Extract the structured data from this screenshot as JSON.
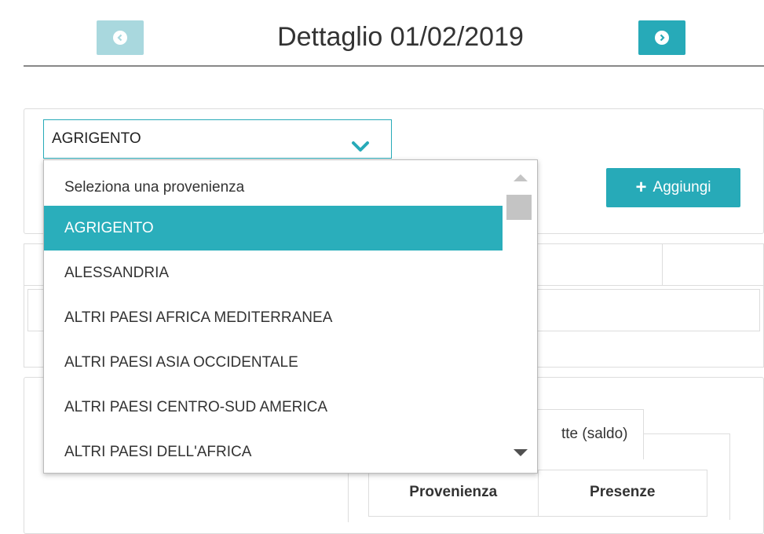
{
  "header": {
    "title": "Dettaglio 01/02/2019",
    "prev_icon": "arrow-left-circle-icon",
    "next_icon": "arrow-right-circle-icon"
  },
  "colors": {
    "accent": "#27aab8",
    "accent_disabled": "#a9d8de",
    "selected_option": "#2aaebb"
  },
  "select": {
    "value": "AGRIGENTO",
    "icon": "chevron-down-icon"
  },
  "dropdown": {
    "options": [
      "Seleziona una provenienza",
      "AGRIGENTO",
      "ALESSANDRIA",
      "ALTRI PAESI AFRICA MEDITERRANEA",
      "ALTRI PAESI ASIA OCCIDENTALE",
      "ALTRI PAESI CENTRO-SUD AMERICA",
      "ALTRI PAESI DELL'AFRICA"
    ],
    "selected_index": 1
  },
  "add_button": {
    "label": "Aggiungi",
    "icon": "plus-icon"
  },
  "tab": {
    "partial_label": "tte (saldo)"
  },
  "table": {
    "headers": [
      "Provenienza",
      "Presenze"
    ]
  }
}
